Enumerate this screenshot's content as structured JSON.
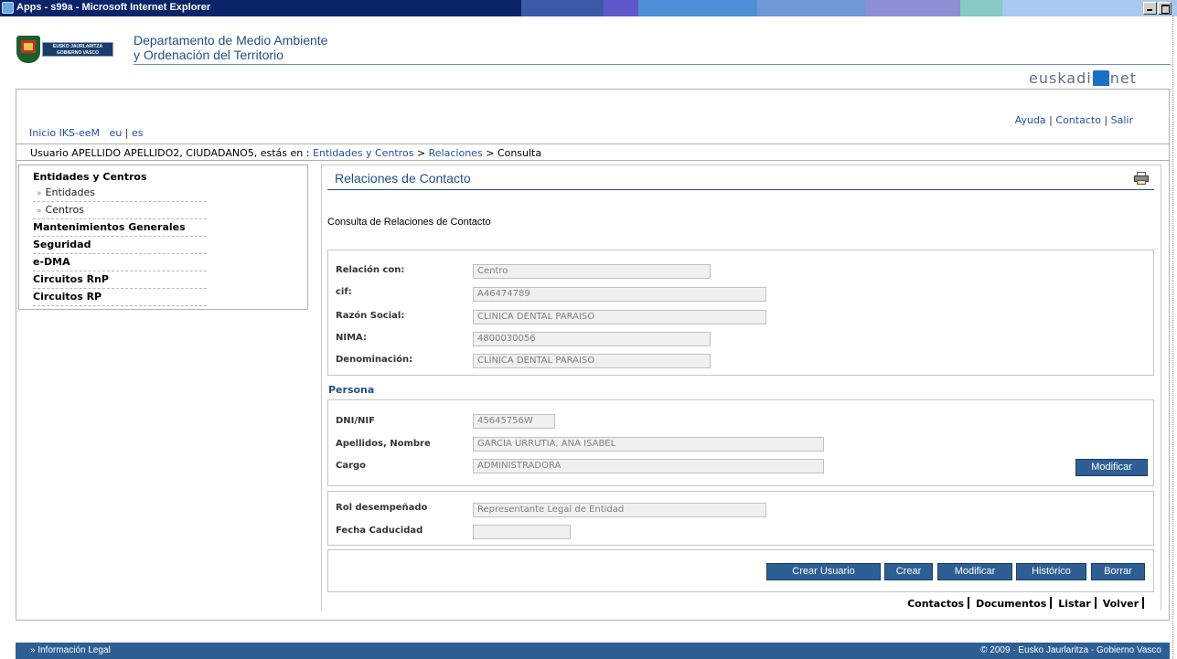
{
  "window": {
    "title": "Apps - s99a - Microsoft Internet Explorer"
  },
  "header": {
    "logo_text": "EUSKO JAURLARITZA GOBIERNO VASCO",
    "dept_line1": "Departamento de Medio Ambiente",
    "dept_line2": "y Ordenación del Territorio",
    "brand_left": "euskadi",
    "brand_right": "net"
  },
  "toplinks": {
    "home": "Inicio IKS-eeM",
    "eu": "eu",
    "sep": "|",
    "es": "es"
  },
  "rightlinks": {
    "help": "Ayuda",
    "contact": "Contacto",
    "logout": "Salir",
    "sep": "|"
  },
  "breadcrumb": {
    "prefix": "Usuario APELLIDO APELLIDO2, CIUDADANO5, estás en :",
    "item1": "Entidades y Centros",
    "arrow": ">",
    "item2": "Relaciones",
    "current": "Consulta"
  },
  "sidebar": {
    "section1": "Entidades y Centros",
    "sub1": "Entidades",
    "sub2": "Centros",
    "arrow": "»",
    "item2": "Mantenimientos Generales",
    "item3": "Seguridad",
    "item4": "e-DMA",
    "item5": "Circuitos RnP",
    "item6": "Circuitos RP"
  },
  "main": {
    "title": "Relaciones de Contacto",
    "subtitle": "Consulta de Relaciones de Contacto",
    "entity": {
      "relacion_label": "Relación con:",
      "relacion_value": "Centro",
      "cif_label": "cif:",
      "cif_value": "A46474789",
      "razon_label": "Razón Social:",
      "razon_value": "CLINICA DENTAL PARAISO",
      "nima_label": "NIMA:",
      "nima_value": "4800030056",
      "denom_label": "Denominación:",
      "denom_value": "CLINICA DENTAL PARAISO"
    },
    "persona": {
      "header": "Persona",
      "dni_label": "DNI/NIF",
      "dni_value": "45645756W",
      "nombre_label": "Apellidos, Nombre",
      "nombre_value": "GARCIA URRUTIA, ANA ISABEL",
      "cargo_label": "Cargo",
      "cargo_value": "ADMINISTRADORA",
      "modify_button": "Modificar"
    },
    "rol": {
      "rol_label": "Rol desempeñado",
      "rol_value": "Representante Legal de Entidad",
      "fecha_label": "Fecha Caducidad",
      "fecha_value": ""
    },
    "actions": {
      "crear_usuario": "Crear Usuario",
      "crear": "Crear",
      "modificar": "Modificar",
      "historico": "Histórico",
      "borrar": "Borrar"
    },
    "bottom_links": {
      "contactos": "Contactos",
      "documentos": "Documentos",
      "listar": "Listar",
      "volver": "Volver"
    }
  },
  "footer": {
    "legal": "» Información Legal",
    "copyright": "© 2009 · Eusko Jaurlaritza - Gobierno Vasco"
  },
  "colors": {
    "titlebar": "#0a246a",
    "accent_blue": "#2e5f94",
    "link_blue": "#1f4fa8",
    "title_blue": "#1f4f8a"
  }
}
